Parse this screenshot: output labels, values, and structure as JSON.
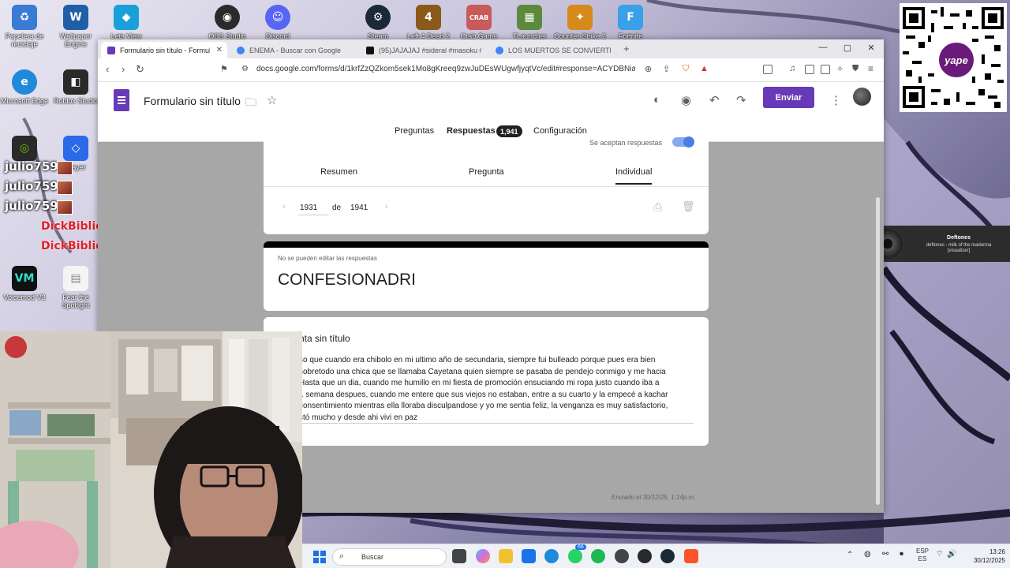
{
  "desktop": {
    "top_icons": [
      {
        "label": "Papelera de reciclaje",
        "icon": "recycle-bin-icon",
        "color": "#3a7bd5"
      },
      {
        "label": "Wallpaper Engine",
        "icon": "wallpaper-engine-icon",
        "color": "#1f5fa8"
      },
      {
        "label": "Lets View",
        "icon": "letsview-icon",
        "color": "#19a0d8"
      },
      {
        "label": "OBS Studio",
        "icon": "obs-icon",
        "color": "#2a2a2a"
      },
      {
        "label": "Discord",
        "icon": "discord-icon",
        "color": "#5865f2"
      },
      {
        "label": "Steam",
        "icon": "steam-icon",
        "color": "#1b2838"
      },
      {
        "label": "Left 4 Dead 2",
        "icon": "left4dead-icon",
        "color": "#8a5a1a"
      },
      {
        "label": "Crab Game",
        "icon": "crabgame-icon",
        "color": "#c85a5a"
      },
      {
        "label": "TLauncher",
        "icon": "tlauncher-icon",
        "color": "#5a8a3a"
      },
      {
        "label": "Counter-Strike 2",
        "icon": "counter-strike-icon",
        "color": "#d68a1a"
      },
      {
        "label": "Fortnite",
        "icon": "fortnite-icon",
        "color": "#3aa0e8"
      }
    ],
    "left_icons": [
      {
        "label": "Microsoft Edge",
        "icon": "edge-icon",
        "color": "#1f8ad8"
      },
      {
        "label": "Roblox Studio",
        "icon": "roblox-studio-icon",
        "color": "#2a2a2a"
      },
      {
        "label": "Player",
        "icon": "roblox-player-icon",
        "color": "#2a6ae8"
      },
      {
        "label": "Voicemod V3",
        "icon": "voicemod-icon",
        "color": "#111111"
      },
      {
        "label": "Fear the Spotlight",
        "icon": "file-icon",
        "color": "#f0f0f0"
      }
    ],
    "chat_lines": [
      {
        "user": "julio759 :"
      },
      {
        "user": "julio759 :"
      },
      {
        "user": "julio759 :"
      }
    ],
    "chat_red_names": [
      "DickBiblick",
      "DickBiblick"
    ],
    "qr_brand": "yape",
    "music_widget": {
      "artist": "Deftones",
      "track": "deftones - milk of the madonna [visualizer]"
    }
  },
  "browser": {
    "tabs": [
      {
        "label": "Formulario sin título - Formulario",
        "active": true,
        "favicon": "forms-favicon",
        "color": "#673ab7"
      },
      {
        "label": "ENEMA - Buscar con Google",
        "active": false,
        "favicon": "google-favicon",
        "color": "#4285f4"
      },
      {
        "label": "(95)JAJAJAJ #sideral #masoku #pa",
        "active": false,
        "favicon": "tiktok-favicon",
        "color": "#111111"
      },
      {
        "label": "LOS MUERTOS SE CONVIERTEN EN R",
        "active": false,
        "favicon": "google-favicon",
        "color": "#4285f4"
      }
    ],
    "url": "docs.google.com/forms/d/1krfZzQZkom5sek1Mo8gKreeq9zwJuDEsWUgwfjyqtVc/edit#response=ACYDBNiaKGTcP6..."
  },
  "form": {
    "title": "Formulario sin título",
    "send_label": "Enviar",
    "tabs": [
      {
        "label": "Preguntas"
      },
      {
        "label": "Respuestas"
      },
      {
        "label": "Configuración"
      }
    ],
    "responses_count": "1,941",
    "accepting_label": "Se aceptan respuestas",
    "subtabs": [
      "Resumen",
      "Pregunta",
      "Individual"
    ],
    "navigator": {
      "current": "1931",
      "of_label": "de",
      "total": "1941"
    },
    "readonly_note": "No se pueden editar las respuestas",
    "response_title": "CONFESIONADRI",
    "question_title": "nta sin título",
    "answer_lines": [
      "so que cuando era chibolo en mi ultimo año de secundaria, siempre fui bulleado porque pues era bien",
      "sobretodo una chica que se llamaba Cayetana quien siempre se pasaba de pendejo conmigo y me hacia",
      "Hasta que un dia, cuando me humillo en mi fiesta de promoción ensuciando mi ropa justo cuando iba a",
      "1 semana despues, cuando me entere que sus viejos no estaban, entre a su cuarto y la empecé a kachar",
      "consentimiento mientras ella lloraba disculpandose y yo me sentia feliz, la venganza es muy satisfactorio,",
      "stó mucho y desde ahi vivi en paz"
    ],
    "sent_note": "Enviado el 30/12/25, 1:14p.m."
  },
  "taskbar": {
    "search_placeholder": "Buscar",
    "apps": [
      {
        "icon": "task-view-icon",
        "color": "#333333"
      },
      {
        "icon": "copilot-icon",
        "color": "#d86adf"
      },
      {
        "icon": "file-explorer-icon",
        "color": "#f2c12e"
      },
      {
        "icon": "store-icon",
        "color": "#1a73e8"
      },
      {
        "icon": "edge-icon",
        "color": "#1f8ad8"
      },
      {
        "icon": "whatsapp-icon",
        "color": "#25d366"
      },
      {
        "icon": "spotify-icon",
        "color": "#1db954"
      },
      {
        "icon": "app-icon",
        "color": "#444444"
      },
      {
        "icon": "xbox-icon",
        "color": "#2a2a2a"
      },
      {
        "icon": "steam-icon",
        "color": "#1b2838"
      },
      {
        "icon": "brave-icon",
        "color": "#fb542b"
      }
    ],
    "whatsapp_badge": "66",
    "language": "ESP",
    "language_sub": "ES",
    "time": "13:26",
    "date": "30/12/2025"
  }
}
